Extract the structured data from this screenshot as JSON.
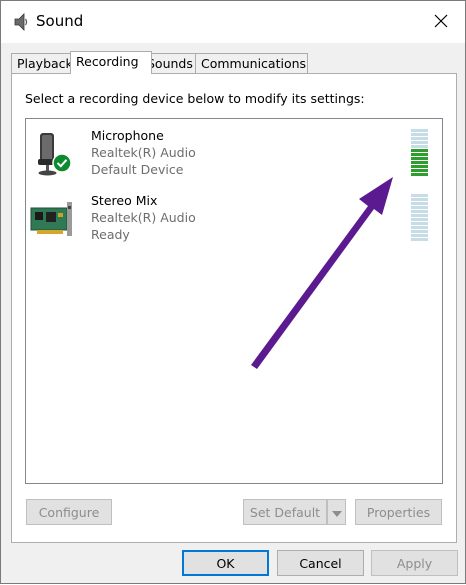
{
  "window": {
    "title": "Sound",
    "title_icon": "speaker-icon",
    "close_icon": "close-icon"
  },
  "tabs": [
    {
      "label": "Playback",
      "active": false
    },
    {
      "label": "Recording",
      "active": true
    },
    {
      "label": "Sounds",
      "active": false
    },
    {
      "label": "Communications",
      "active": false
    }
  ],
  "instruction": "Select a recording device below to modify its settings:",
  "devices": [
    {
      "name": "Microphone",
      "driver": "Realtek(R) Audio",
      "status": "Default Device",
      "icon": "microphone-icon",
      "default_badge": "check-icon",
      "level_fraction": 0.6
    },
    {
      "name": "Stereo Mix",
      "driver": "Realtek(R) Audio",
      "status": "Ready",
      "icon": "sound-card-icon",
      "level_fraction": 0
    }
  ],
  "panel_buttons": {
    "configure": "Configure",
    "set_default": "Set Default",
    "properties": "Properties"
  },
  "dialog_buttons": {
    "ok": "OK",
    "cancel": "Cancel",
    "apply": "Apply"
  },
  "colors": {
    "meter_active": "#2e9e2e",
    "meter_inactive": "#c6dde8",
    "annotation_arrow": "#5b1a8f",
    "check_badge": "#0e8a2e"
  }
}
